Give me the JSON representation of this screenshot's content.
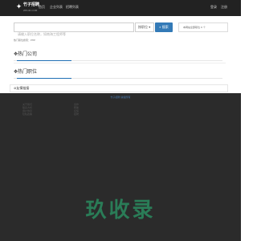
{
  "nav": {
    "logo_mark": "✦",
    "logo_title": "竹子招聘",
    "logo_subtitle": "ZHUZI.COM",
    "items": [
      "首页",
      "企业列表",
      "招聘列表"
    ],
    "login": "登录",
    "register": "注册"
  },
  "search": {
    "placeholder": "请输入职位名称，如南海工程师等",
    "type_selected": "按职位",
    "type_caret": "▾",
    "button_icon": "⌕",
    "button_label": "搜索",
    "hot_tip": "本网站全部职位 0 个"
  },
  "breadcrumb": "热门职位搜索：PHP",
  "sections": {
    "hot_companies": "热门公司",
    "hot_positions": "热门职位",
    "marker": "✥"
  },
  "friend_links": {
    "icon": "⊘",
    "label": "友情链接"
  },
  "footer": {
    "heading": "竹子招聘 版权所有",
    "col1": [
      "关于我们",
      "联系方式",
      "用户协议",
      "隐私政策"
    ],
    "col2": [
      "合作",
      "帮助",
      "反馈",
      "招聘"
    ]
  },
  "watermark": "玖收录",
  "colors": {
    "nav_bg": "#222222",
    "accent": "#337ab7",
    "footer_bg": "#2b2b2b",
    "watermark": "#2aa86e"
  }
}
